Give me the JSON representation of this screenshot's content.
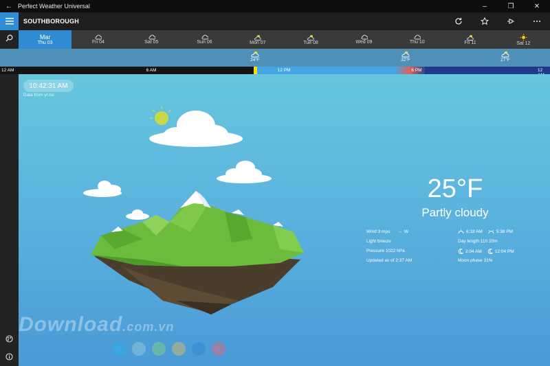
{
  "window": {
    "title": "Perfect Weather Universal"
  },
  "header": {
    "city": "SOUTHBOROUGH"
  },
  "days": [
    {
      "name": "Mar",
      "date": "Thu 03",
      "active": true
    },
    {
      "name": "",
      "date": "Fri 04",
      "icon": "cloud-icon"
    },
    {
      "name": "",
      "date": "Sat 05",
      "icon": "cloud-icon"
    },
    {
      "name": "",
      "date": "Sun 06",
      "icon": "cloud-icon"
    },
    {
      "name": "",
      "date": "Mon 07",
      "icon": "sun-cloud-icon"
    },
    {
      "name": "",
      "date": "Tue 08",
      "icon": "sun-cloud-icon"
    },
    {
      "name": "",
      "date": "Wed 09",
      "icon": "cloud-icon"
    },
    {
      "name": "",
      "date": "Thu 10",
      "icon": "cloud-icon"
    },
    {
      "name": "",
      "date": "Fri 11",
      "icon": "sun-cloud-icon"
    },
    {
      "name": "",
      "date": "Sat 12",
      "icon": "sun-icon"
    }
  ],
  "hourly": [
    {
      "temp": "24°F"
    },
    {
      "temp": "32°F"
    },
    {
      "temp": "27°F"
    }
  ],
  "timeline": {
    "t1": "12 AM",
    "t2": "6 AM",
    "t3": "12 PM",
    "t4": "6 PM",
    "t5": "12 AM"
  },
  "main": {
    "clock": "10:42:31 AM",
    "source": "Data from yr.no",
    "temperature": "25°F",
    "condition": "Partly cloudy",
    "wind": "Wind 3 mps",
    "wind_dir": "W",
    "breeze": "Light breeze",
    "pressure": "Pressure 1022 hPa",
    "updated": "Updated as of 2:37 AM",
    "sunrise": "6:18 AM",
    "sunset": "5:38 PM",
    "day_length": "Day length 11h 20m",
    "moonrise": "2:04 AM",
    "moonset": "12:04 PM",
    "moon_phase": "Moon phase 31%"
  },
  "watermark": {
    "main": "Download",
    "suffix": ".com.vn"
  },
  "colors": {
    "accent": "#2f8bd2",
    "theme_dots": [
      "#36a9e1",
      "#7fb9d8",
      "#6fbf9e",
      "#a8b08a",
      "#3a8fd0",
      "#b07a9a"
    ]
  }
}
